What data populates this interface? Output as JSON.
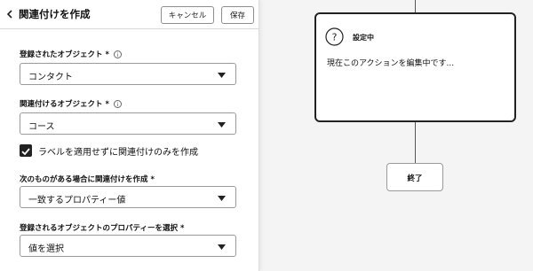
{
  "header": {
    "title": "関連付けを作成",
    "cancel_label": "キャンセル",
    "save_label": "保存"
  },
  "form": {
    "registered_object": {
      "label": "登録されたオブジェクト *",
      "value": "コンタクト"
    },
    "associated_object": {
      "label": "関連付けるオブジェクト *",
      "value": "コース"
    },
    "checkbox": {
      "label": "ラベルを適用せずに関連付けのみを作成",
      "checked": true
    },
    "condition": {
      "label": "次のものがある場合に関連付けを作成 *",
      "value": "一致するプロパティー値"
    },
    "property": {
      "label": "登録されるオブジェクトのプロパティーを選択 *",
      "placeholder": "値を選択"
    }
  },
  "canvas": {
    "action_card": {
      "status": "設定中",
      "message": "現在このアクションを編集中です..."
    },
    "end_node_label": "終了"
  },
  "icons": {
    "back": "chevron-left-icon",
    "info": "info-icon",
    "caret": "caret-down-icon",
    "check": "check-icon",
    "question": "question-icon"
  },
  "colors": {
    "primary_text": "#111111",
    "checkbox_fill": "#222222",
    "canvas_bg": "#f4f4f4",
    "card_border": "#222222"
  }
}
